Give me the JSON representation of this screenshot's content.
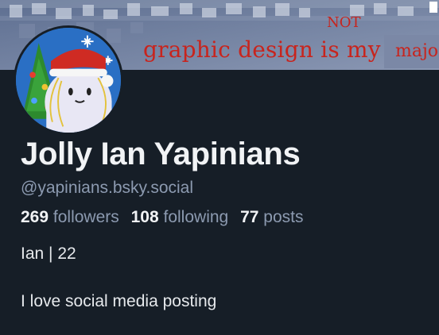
{
  "banner": {
    "text": "graphic design is my",
    "insert_word": "NOT",
    "cut_word": "majo"
  },
  "profile": {
    "display_name": "Jolly Ian Yapinians",
    "handle": "@yapinians.bsky.social",
    "stats": {
      "followers_count": "269",
      "followers_label": "followers",
      "following_count": "108",
      "following_label": "following",
      "posts_count": "77",
      "posts_label": "posts"
    },
    "bio_line1": "Ian | 22",
    "bio_line2": "I love social media posting"
  },
  "colors": {
    "background": "#161e27",
    "text": "#f1f3f5",
    "muted": "#8c9ab0",
    "banner_red": "#c8241d"
  }
}
